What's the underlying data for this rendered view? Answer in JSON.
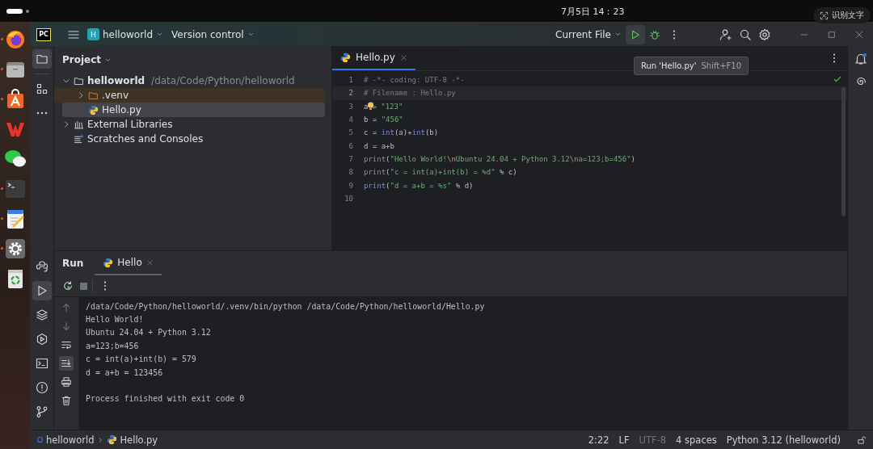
{
  "top_bar": {
    "clock": "7月5日 14：23",
    "ocr_button": "识别文字"
  },
  "dock": [
    {
      "kind": "browser",
      "running": true
    },
    {
      "kind": "files",
      "running": true
    },
    {
      "kind": "store",
      "running": true
    },
    {
      "kind": "office",
      "running": false
    },
    {
      "kind": "chat",
      "running": false
    },
    {
      "kind": "terminal",
      "running": true
    },
    {
      "kind": "notes",
      "running": true
    },
    {
      "kind": "settings",
      "running": true
    },
    {
      "kind": "trash",
      "running": false
    }
  ],
  "ide": {
    "logo": "PC",
    "project_badge": "H",
    "project": "helloworld",
    "vcs": "Version control",
    "run_config": "Current File",
    "tool_strip_top": [
      {
        "kind": "folder",
        "selected": true
      },
      {
        "kind": "structure",
        "selected": false
      },
      {
        "kind": "more",
        "selected": false
      }
    ],
    "tool_strip_bottom": [
      {
        "kind": "python",
        "selected": false
      },
      {
        "kind": "run",
        "selected": true
      },
      {
        "kind": "layers",
        "selected": false
      },
      {
        "kind": "services",
        "selected": false
      },
      {
        "kind": "terminal",
        "selected": false
      },
      {
        "kind": "problems",
        "selected": false
      },
      {
        "kind": "git",
        "selected": false
      }
    ],
    "project_panel": {
      "title": "Project",
      "tree": [
        {
          "kind": "module",
          "label": "helloworld",
          "path": "/data/Code/Python/helloworld",
          "expanded": true,
          "selected": false,
          "children": [
            {
              "kind": "excluded-folder",
              "label": ".venv",
              "expanded": false,
              "selected": false
            },
            {
              "kind": "python-file",
              "label": "Hello.py",
              "selected": true
            }
          ]
        },
        {
          "kind": "libraries",
          "label": "External Libraries",
          "expanded": false,
          "selected": false
        },
        {
          "kind": "scratches",
          "label": "Scratches and Consoles",
          "selected": false
        }
      ]
    },
    "editor": {
      "tabs": [
        {
          "label": "Hello.py",
          "selected": true
        }
      ],
      "lines": [
        {
          "number": "1",
          "selected": false,
          "tokens": [
            {
              "kind": "comment",
              "text": "# -*- coding: UTF-8 -*-"
            }
          ]
        },
        {
          "number": "2",
          "selected": true,
          "tokens": [
            {
              "kind": "comment",
              "text": "# Filename : Hello.py"
            }
          ]
        },
        {
          "number": "3",
          "selected": false,
          "tokens": [
            {
              "kind": "plain",
              "text": "a"
            },
            {
              "kind": "bulb"
            },
            {
              "kind": "plain",
              "text": "= "
            },
            {
              "kind": "string",
              "text": "\"123\""
            }
          ]
        },
        {
          "number": "4",
          "selected": false,
          "tokens": [
            {
              "kind": "plain",
              "text": "b = "
            },
            {
              "kind": "string",
              "text": "\"456\""
            }
          ]
        },
        {
          "number": "5",
          "selected": false,
          "tokens": [
            {
              "kind": "plain",
              "text": "c = "
            },
            {
              "kind": "builtin",
              "text": "int"
            },
            {
              "kind": "plain",
              "text": "(a)+"
            },
            {
              "kind": "builtin",
              "text": "int"
            },
            {
              "kind": "plain",
              "text": "(b)"
            }
          ]
        },
        {
          "number": "6",
          "selected": false,
          "tokens": [
            {
              "kind": "plain",
              "text": "d = a+b"
            }
          ]
        },
        {
          "number": "7",
          "selected": false,
          "tokens": [
            {
              "kind": "builtin",
              "text": "print"
            },
            {
              "kind": "plain",
              "text": "("
            },
            {
              "kind": "string",
              "text": "\"Hello World!"
            },
            {
              "kind": "escape",
              "text": "\\n"
            },
            {
              "kind": "string",
              "text": "Ubuntu 24.04 + Python 3.12"
            },
            {
              "kind": "escape",
              "text": "\\n"
            },
            {
              "kind": "string",
              "text": "a=123;b=456\""
            },
            {
              "kind": "plain",
              "text": ")"
            }
          ]
        },
        {
          "number": "8",
          "selected": false,
          "tokens": [
            {
              "kind": "builtin",
              "text": "print"
            },
            {
              "kind": "plain",
              "text": "("
            },
            {
              "kind": "string",
              "text": "\"c = int(a)+int(b) = %d\""
            },
            {
              "kind": "plain",
              "text": " % c)"
            }
          ]
        },
        {
          "number": "9",
          "selected": false,
          "tokens": [
            {
              "kind": "builtin",
              "text": "print"
            },
            {
              "kind": "plain",
              "text": "("
            },
            {
              "kind": "string",
              "text": "\"d = a+b = %s\""
            },
            {
              "kind": "plain",
              "text": " % d)"
            }
          ]
        },
        {
          "number": "10",
          "selected": false
        }
      ]
    },
    "tooltip": {
      "action": "Run 'Hello.py'",
      "shortcut": "Shift+F10"
    },
    "run_panel": {
      "title": "Run",
      "tabs": [
        {
          "label": "Hello",
          "selected": true
        }
      ],
      "gutter": [
        {
          "kind": "up",
          "selected": false
        },
        {
          "kind": "down",
          "selected": false
        },
        {
          "kind": "wrap",
          "selected": false
        },
        {
          "kind": "scroll-end",
          "selected": true
        },
        {
          "kind": "print",
          "selected": false
        },
        {
          "kind": "trash",
          "selected": false
        }
      ],
      "output": [
        {
          "kind": "command",
          "text": "/data/Code/Python/helloworld/.venv/bin/python /data/Code/Python/helloworld/Hello.py"
        },
        {
          "kind": "stdout",
          "text": "Hello World!"
        },
        {
          "kind": "stdout",
          "text": "Ubuntu 24.04 + Python 3.12"
        },
        {
          "kind": "stdout",
          "text": "a=123;b=456"
        },
        {
          "kind": "stdout",
          "text": "c = int(a)+int(b) = 579"
        },
        {
          "kind": "stdout",
          "text": "d = a+b = 123456"
        },
        {
          "kind": "status",
          "text": "Process finished with exit code 0"
        }
      ]
    },
    "status_bar": {
      "breadcrumb": [
        "helloworld",
        "Hello.py"
      ],
      "items": [
        {
          "text": "2:22",
          "disabled": false
        },
        {
          "text": "LF",
          "disabled": false
        },
        {
          "text": "UTF-8",
          "disabled": true
        },
        {
          "text": "4 spaces",
          "disabled": false
        },
        {
          "text": "Python 3.12 (helloworld)",
          "disabled": false
        }
      ]
    }
  }
}
